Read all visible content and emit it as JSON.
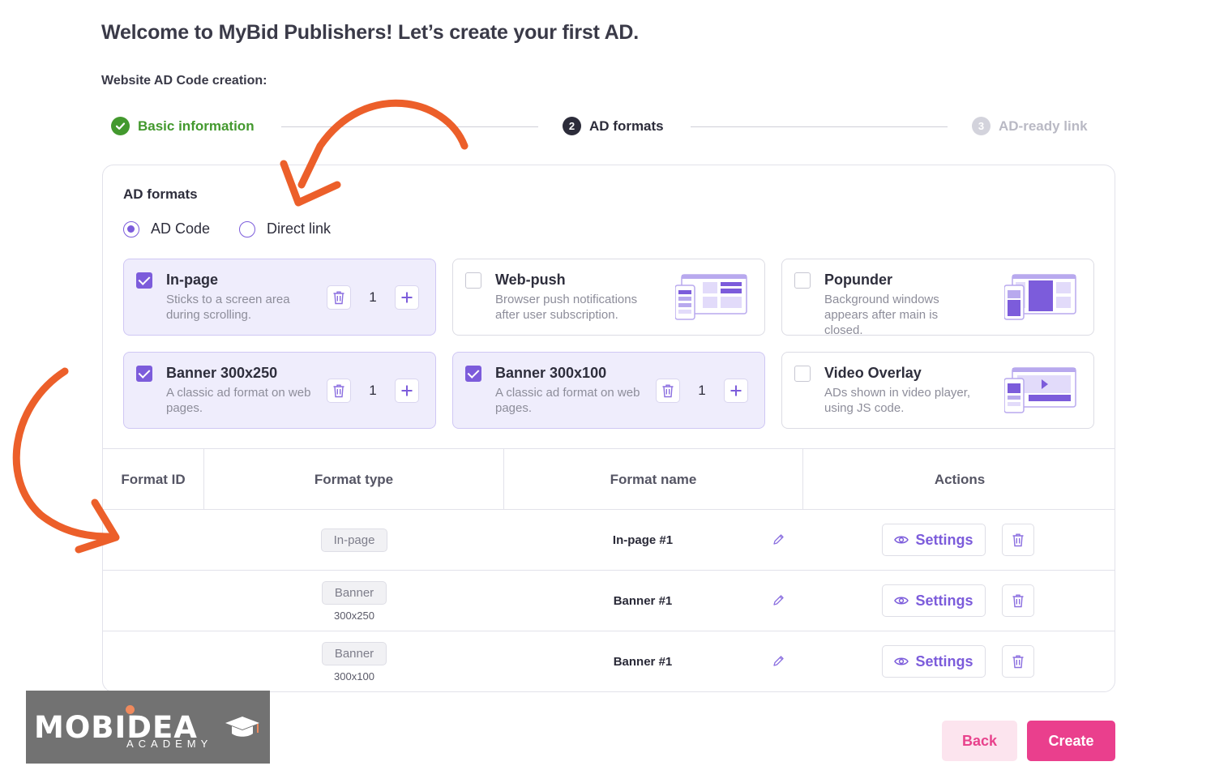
{
  "page": {
    "title": "Welcome to MyBid Publishers! Let’s create your first AD.",
    "section_label": "Website AD Code creation:"
  },
  "stepper": [
    {
      "number": "✓",
      "label": "Basic information",
      "state": "done"
    },
    {
      "number": "2",
      "label": "AD formats",
      "state": "current"
    },
    {
      "number": "3",
      "label": "AD-ready link",
      "state": "upcoming"
    }
  ],
  "ad_formats": {
    "title": "AD formats",
    "mode_options": [
      {
        "label": "AD Code",
        "selected": true
      },
      {
        "label": "Direct link",
        "selected": false
      }
    ],
    "cards": [
      {
        "name": "In-page",
        "desc": "Sticks to a screen area during scrolling.",
        "selected": true,
        "qty": "1"
      },
      {
        "name": "Web-push",
        "desc": "Browser push notifications after user subscription.",
        "selected": false
      },
      {
        "name": "Popunder",
        "desc": "Background windows appears after main is closed.",
        "selected": false
      },
      {
        "name": "Banner 300x250",
        "desc": "A classic ad format on web pages.",
        "selected": true,
        "qty": "1"
      },
      {
        "name": "Banner 300x100",
        "desc": "A classic ad format on web pages.",
        "selected": true,
        "qty": "1"
      },
      {
        "name": "Video Overlay",
        "desc": "ADs shown in video player, using JS code.",
        "selected": false
      }
    ]
  },
  "table": {
    "headers": [
      "Format ID",
      "Format type",
      "Format name",
      "Actions"
    ],
    "rows": [
      {
        "id": "",
        "type": "In-page",
        "type_sub": "",
        "name": "In-page #1",
        "action_label": "Settings"
      },
      {
        "id": "",
        "type": "Banner",
        "type_sub": "300x250",
        "name": "Banner #1",
        "action_label": "Settings"
      },
      {
        "id": "",
        "type": "Banner",
        "type_sub": "300x100",
        "name": "Banner #1",
        "action_label": "Settings"
      }
    ]
  },
  "footer": {
    "back_label": "Back",
    "create_label": "Create"
  },
  "watermark": {
    "brand": "MOBIDEA",
    "sub": "ACADEMY"
  },
  "colors": {
    "accent": "#7c5cdb",
    "success": "#43992e",
    "primary_button": "#ea3f8d",
    "annotation_arrow": "#ec5f2a"
  }
}
